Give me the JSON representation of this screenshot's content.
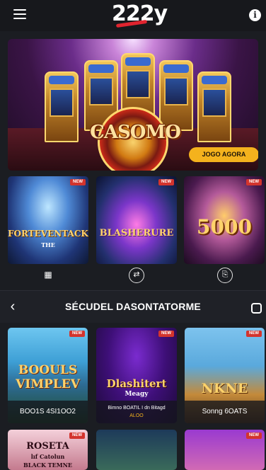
{
  "header": {
    "logo_text": "222y",
    "info_glyph": "i",
    "icons": {
      "menu": "hamburger-menu-icon",
      "info": "info-icon"
    }
  },
  "hero": {
    "title": "CASOMO",
    "cta_label": "JOGO AGORA"
  },
  "featured": [
    {
      "title": "FORTEVENTACKE",
      "subtitle": "THE",
      "badge": "NEW",
      "icon_glyph": "▦",
      "icon": "grid-icon"
    },
    {
      "title": "BLASHERURE",
      "badge": "NEW",
      "icon_glyph": "⇄",
      "icon": "swap-circle-icon"
    },
    {
      "title": "5000",
      "badge": "NEW",
      "icon_glyph": "⎘",
      "icon": "wallet-icon"
    }
  ],
  "section": {
    "back_glyph": "‹",
    "title": "SÉCUDEL DASONTATORME",
    "icons": {
      "back": "chevron-left-icon",
      "action": "square-icon"
    }
  },
  "games": [
    {
      "title": "BOOULS VIMPLEV",
      "caption": "BOO1S 4SI1OO2",
      "badge": "NEW"
    },
    {
      "title": "Dlashitert",
      "subtitle": "Meagy",
      "caption": "Bimno BOATIL I dn Bitagd",
      "caption2": "ALOO",
      "badge": "NEW"
    },
    {
      "title": "NKNE",
      "caption": "Sonng 6OATS",
      "badge": "NEW"
    },
    {
      "title": "ROSETA",
      "subtitle": "lıf Catolun",
      "subtitle2": "BLACK TEMNE",
      "badge": "NEW"
    },
    {
      "title": "",
      "badge": ""
    },
    {
      "title": "",
      "badge": "NEW"
    }
  ],
  "colors": {
    "background": "#1b1d22",
    "accent": "#f4b21d",
    "badge": "#d3342d",
    "logo_swoosh": "#e0242f"
  }
}
